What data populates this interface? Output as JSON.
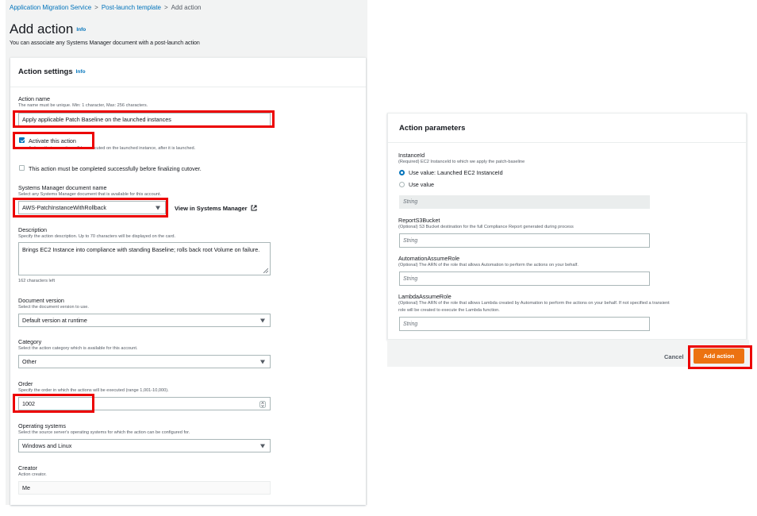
{
  "breadcrumb": {
    "root": "Application Migration Service",
    "parent": "Post-launch template",
    "current": "Add action"
  },
  "page": {
    "title": "Add action",
    "info": "Info",
    "description": "You can associate any Systems Manager document with a post-launch action"
  },
  "settings": {
    "title": "Action settings",
    "info": "Info",
    "action_name": {
      "label": "Action name",
      "hint": "The name must be unique. Min: 1 character, Max: 256 characters.",
      "value": "Apply applicable Patch Baseline on the launched instances"
    },
    "activate": {
      "label": "Activate this action",
      "hint": "Actions that are active will be executed on the launched instance, after it is launched.",
      "checked": true
    },
    "must_complete": {
      "label": "This action must be completed successfully before finalizing cutover.",
      "checked": false
    },
    "ssm_document": {
      "label": "Systems Manager document name",
      "hint": "Select any Systems Manager document that is available for this account.",
      "value": "AWS-PatchInstanceWithRollback",
      "link": "View in Systems Manager"
    },
    "description": {
      "label": "Description",
      "hint": "Specify the action description. Up to 70 characters will be displayed on the card.",
      "value": "Brings EC2 Instance into compliance with standing Baseline; rolls back root Volume on failure.",
      "counter": "162 characters left"
    },
    "document_version": {
      "label": "Document version",
      "hint": "Select the document version to use.",
      "value": "Default version at runtime"
    },
    "category": {
      "label": "Category",
      "hint": "Select the action category which is available for this account.",
      "value": "Other"
    },
    "order": {
      "label": "Order",
      "hint": "Specify the order in which the actions will be executed (range 1,001-10,000).",
      "value": "1002"
    },
    "operating_systems": {
      "label": "Operating systems",
      "hint": "Select the source server's operating systems for which the action can be configured for.",
      "value": "Windows and Linux"
    },
    "creator": {
      "label": "Creator",
      "hint": "Action creator.",
      "value": "Me"
    }
  },
  "parameters": {
    "title": "Action parameters",
    "instance_id": {
      "label": "InstanceId",
      "hint": "(Required) EC2 InstanceId to which we apply the patch-baseline",
      "option_1": "Use value: Launched EC2 InstanceId",
      "option_2": "Use value",
      "placeholder": "String"
    },
    "report_bucket": {
      "label": "ReportS3Bucket",
      "hint": "(Optional) S3 Bucket destination for the full Compliance Report generated during process",
      "placeholder": "String"
    },
    "automation_role": {
      "label": "AutomationAssumeRole",
      "hint": "(Optional) The ARN of the role that allows Automation to perform the actions on your behalf.",
      "placeholder": "String"
    },
    "lambda_role": {
      "label": "LambdaAssumeRole",
      "hint_line1": "(Optional) The ARN of the role that allows Lambda created by Automation to perform the actions on your behalf. If not specified a transient",
      "hint_line2": "role will be created to execute the Lambda function.",
      "placeholder": "String"
    }
  },
  "footer": {
    "cancel": "Cancel",
    "submit": "Add action"
  },
  "colors": {
    "link": "#0073bb",
    "primary": "#ec7211",
    "highlight": "#ec0000"
  }
}
